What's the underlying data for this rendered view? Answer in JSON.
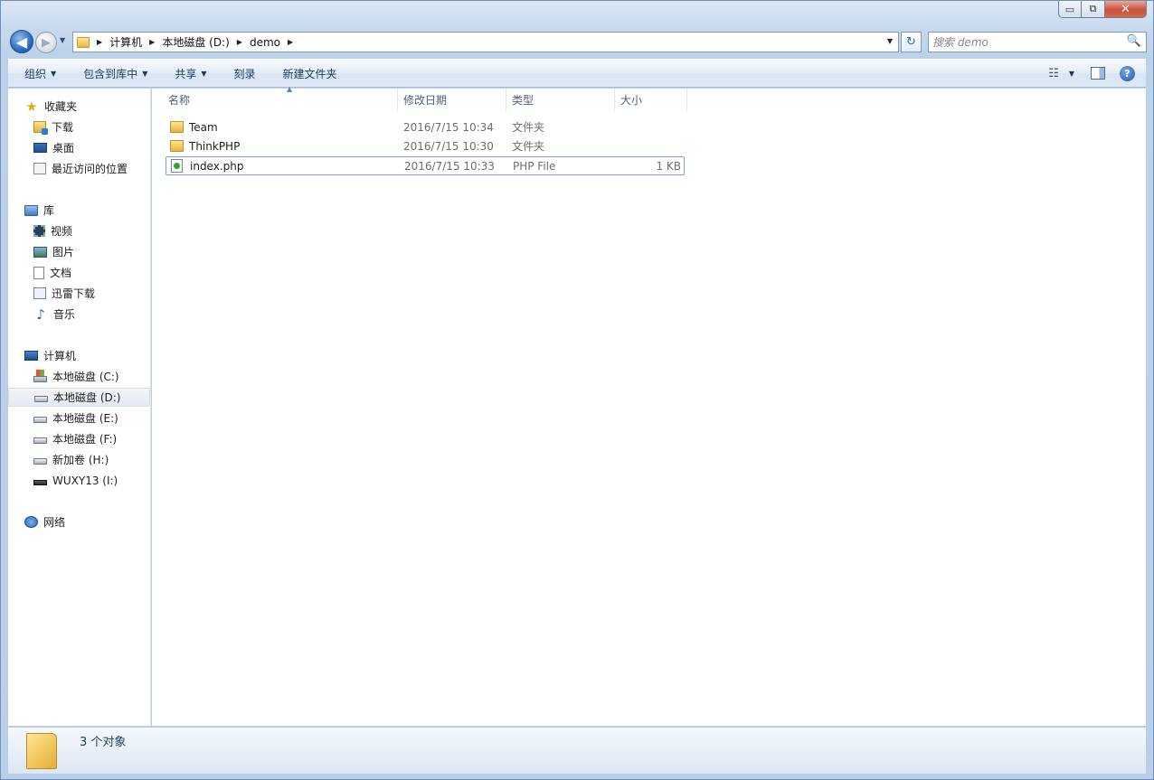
{
  "window": {
    "controls": {
      "minimize": "▭",
      "maximize": "⧉",
      "close": "✕"
    }
  },
  "nav": {
    "back_icon": "◀",
    "forward_icon": "▶",
    "history_dropdown": "▼",
    "breadcrumbs": [
      "计算机",
      "本地磁盘 (D:)",
      "demo"
    ],
    "address_dropdown": "▼",
    "refresh_icon": "↻",
    "search_placeholder": "搜索 demo",
    "search_icon": "🔍"
  },
  "toolbar": {
    "items": [
      {
        "label": "组织",
        "dropdown": true
      },
      {
        "label": "包含到库中",
        "dropdown": true
      },
      {
        "label": "共享",
        "dropdown": true
      },
      {
        "label": "刻录",
        "dropdown": false
      },
      {
        "label": "新建文件夹",
        "dropdown": false
      }
    ],
    "view_icon": "☷",
    "help_icon": "?"
  },
  "sidebar": {
    "favorites": {
      "label": "收藏夹",
      "items": [
        "下载",
        "桌面",
        "最近访问的位置"
      ]
    },
    "libraries": {
      "label": "库",
      "items": [
        "视频",
        "图片",
        "文档",
        "迅雷下载",
        "音乐"
      ]
    },
    "computer": {
      "label": "计算机",
      "items": [
        "本地磁盘 (C:)",
        "本地磁盘 (D:)",
        "本地磁盘 (E:)",
        "本地磁盘 (F:)",
        "新加卷 (H:)",
        "WUXY13 (I:)"
      ],
      "selected": "本地磁盘 (D:)"
    },
    "network": {
      "label": "网络"
    }
  },
  "content": {
    "columns": [
      "名称",
      "修改日期",
      "类型",
      "大小"
    ],
    "files": [
      {
        "name": "Team",
        "modified": "2016/7/15 10:34",
        "type": "文件夹",
        "size": "",
        "icon": "folder-icon"
      },
      {
        "name": "ThinkPHP",
        "modified": "2016/7/15 10:30",
        "type": "文件夹",
        "size": "",
        "icon": "folder-icon"
      },
      {
        "name": "index.php",
        "modified": "2016/7/15 10:33",
        "type": "PHP File",
        "size": "1 KB",
        "icon": "php-file-icon"
      }
    ]
  },
  "status": {
    "text": "3 个对象"
  },
  "colors": {
    "accent": "#2a6cc2",
    "selection_border": "#7da2ce"
  }
}
